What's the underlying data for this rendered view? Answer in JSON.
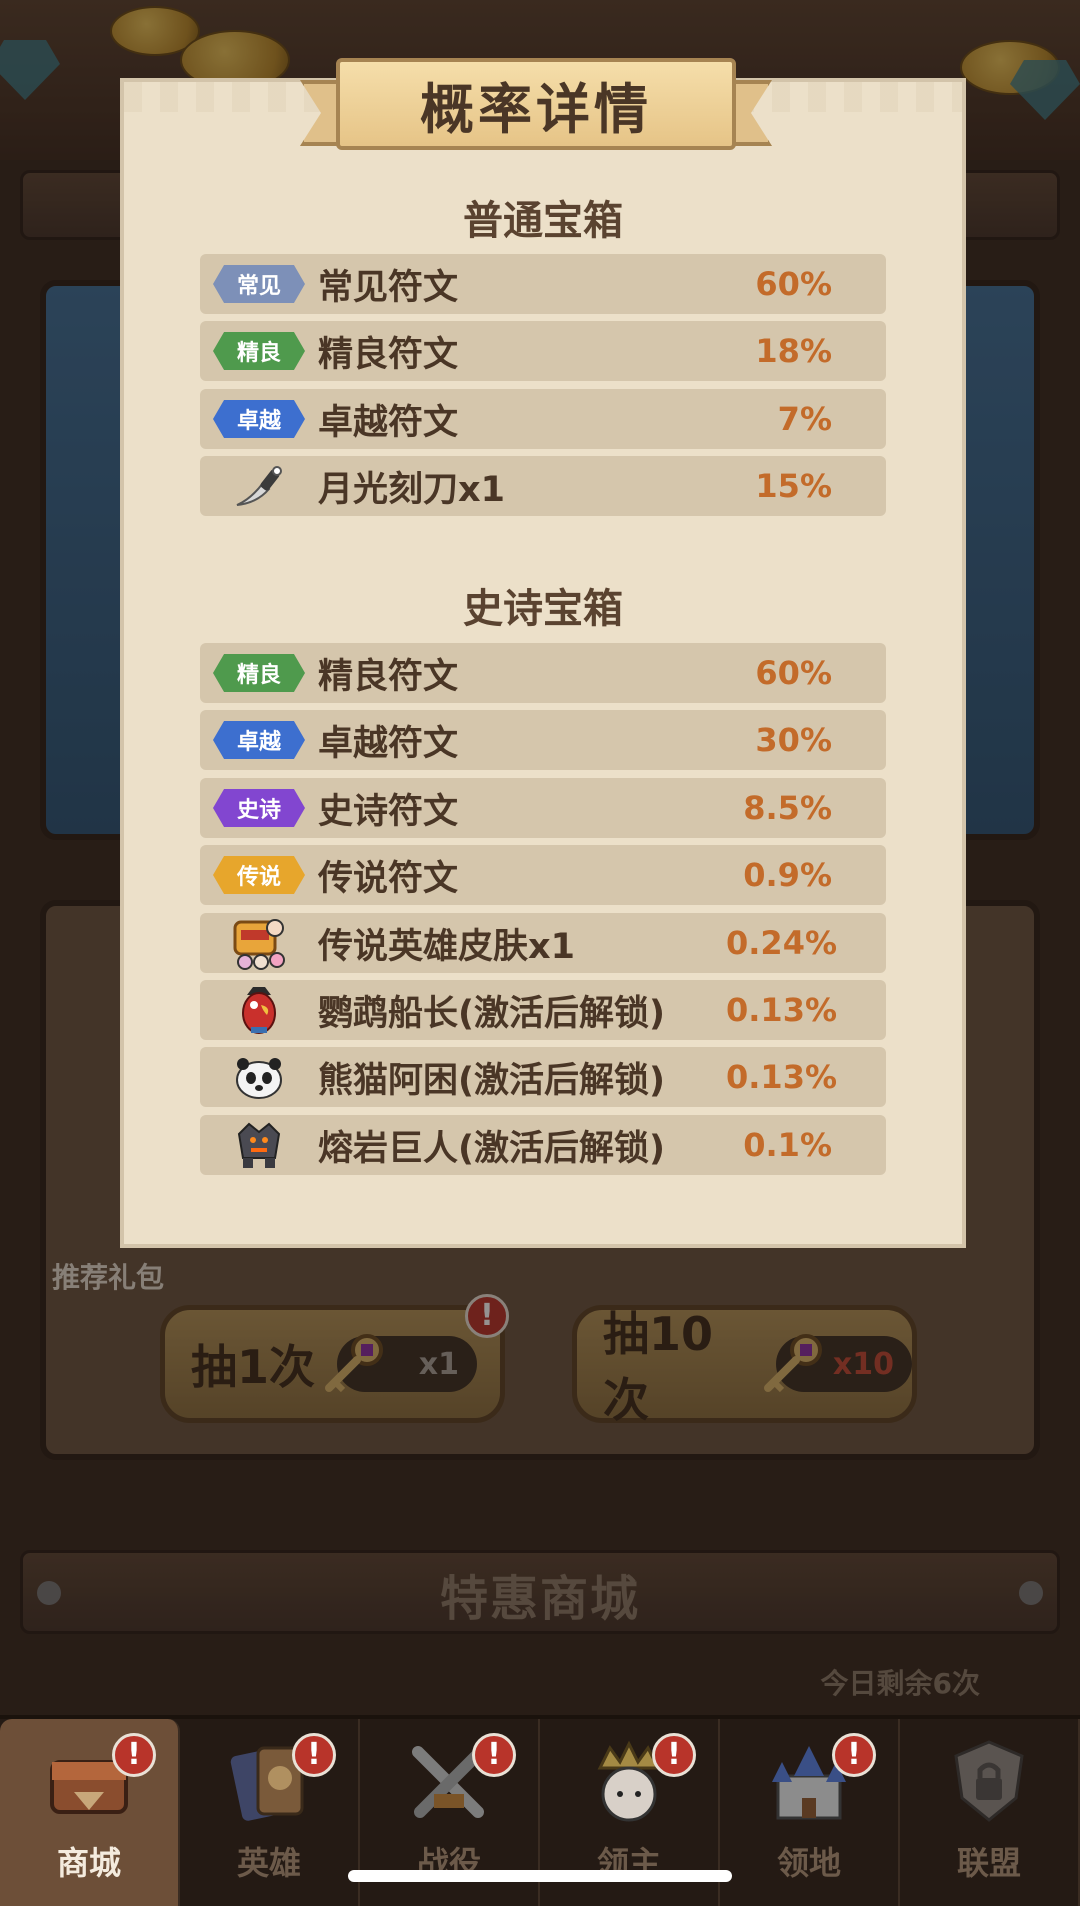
{
  "modal": {
    "title": "概率详情",
    "sections": [
      {
        "title": "普通宝箱",
        "rows": [
          {
            "badge": "常见",
            "badge_class": "b-common",
            "icon": "",
            "name": "常见符文",
            "pct": "60%"
          },
          {
            "badge": "精良",
            "badge_class": "b-fine",
            "icon": "",
            "name": "精良符文",
            "pct": "18%"
          },
          {
            "badge": "卓越",
            "badge_class": "b-superb",
            "icon": "",
            "name": "卓越符文",
            "pct": "7%"
          },
          {
            "badge": "",
            "badge_class": "",
            "icon": "knife-icon",
            "name": "月光刻刀x1",
            "pct": "15%"
          }
        ]
      },
      {
        "title": "史诗宝箱",
        "rows": [
          {
            "badge": "精良",
            "badge_class": "b-fine",
            "icon": "",
            "name": "精良符文",
            "pct": "60%"
          },
          {
            "badge": "卓越",
            "badge_class": "b-superb",
            "icon": "",
            "name": "卓越符文",
            "pct": "30%"
          },
          {
            "badge": "史诗",
            "badge_class": "b-epic",
            "icon": "",
            "name": "史诗符文",
            "pct": "8.5%"
          },
          {
            "badge": "传说",
            "badge_class": "b-legend",
            "icon": "",
            "name": "传说符文",
            "pct": "0.9%"
          },
          {
            "badge": "",
            "badge_class": "",
            "icon": "hero-skin-chest-icon",
            "name": "传说英雄皮肤x1",
            "pct": "0.24%"
          },
          {
            "badge": "",
            "badge_class": "",
            "icon": "parrot-captain-icon",
            "name": "鹦鹉船长(激活后解锁)",
            "pct": "0.13%"
          },
          {
            "badge": "",
            "badge_class": "",
            "icon": "panda-icon",
            "name": "熊猫阿困(激活后解锁)",
            "pct": "0.13%"
          },
          {
            "badge": "",
            "badge_class": "",
            "icon": "lava-giant-icon",
            "name": "熔岩巨人(激活后解锁)",
            "pct": "0.1%"
          }
        ]
      }
    ]
  },
  "background": {
    "recommend_label": "推荐礼包",
    "draw_once": {
      "label": "抽1次",
      "cost": "x1"
    },
    "draw_ten": {
      "label": "抽10次",
      "cost": "x10"
    },
    "special_shop_title": "特惠商城",
    "remaining_today": "今日剩余6次"
  },
  "nav": {
    "items": [
      {
        "label": "商城",
        "icon": "shop-chest-icon",
        "active": true
      },
      {
        "label": "英雄",
        "icon": "hero-cards-icon",
        "active": false
      },
      {
        "label": "战役",
        "icon": "crossed-swords-icon",
        "active": false
      },
      {
        "label": "领主",
        "icon": "lord-crown-icon",
        "active": false
      },
      {
        "label": "领地",
        "icon": "castle-icon",
        "active": false
      },
      {
        "label": "联盟",
        "icon": "alliance-locked-icon",
        "active": false
      }
    ]
  },
  "colors": {
    "percent": "#c36b2a",
    "row_bg": "#d5c6ac",
    "modal_bg": "#ece0c9",
    "alert": "#b8342a"
  }
}
